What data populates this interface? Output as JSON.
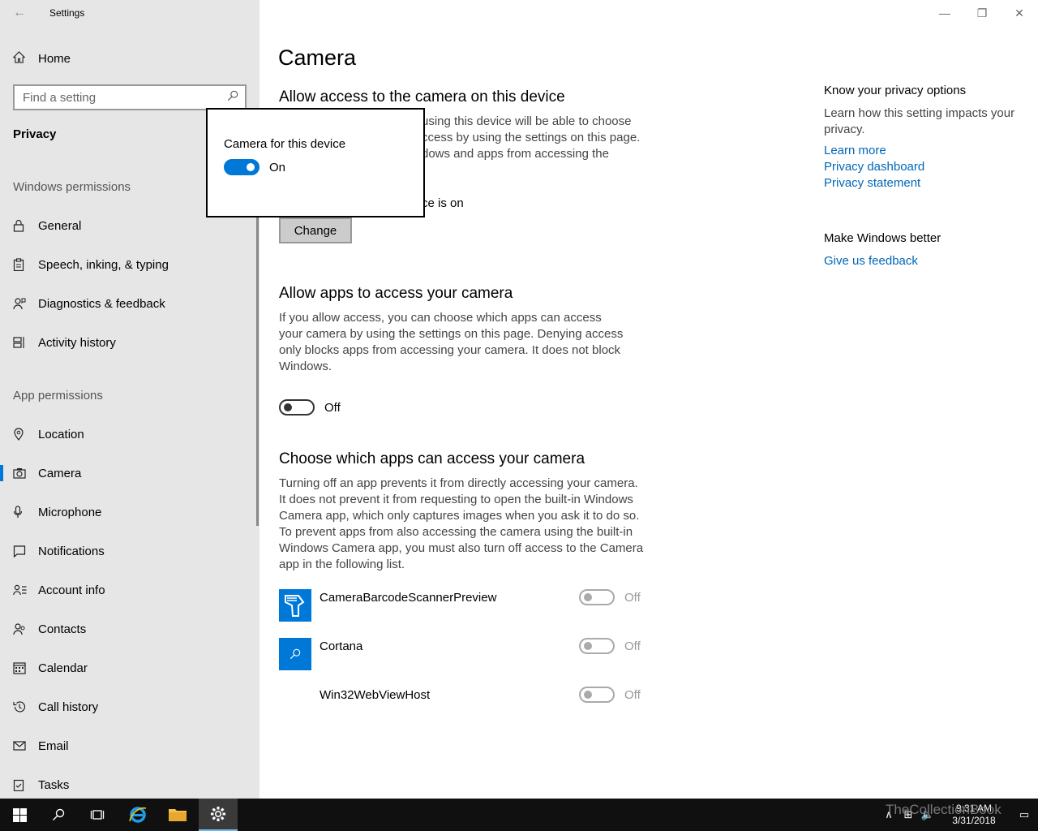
{
  "window": {
    "title": "Settings",
    "minimize_glyph": "—",
    "restore_glyph": "❐",
    "close_glyph": "✕"
  },
  "sidebar": {
    "home_label": "Home",
    "search_placeholder": "Find a setting",
    "section_title": "Privacy",
    "windows_permissions_label": "Windows permissions",
    "windows_permissions": [
      {
        "label": "General",
        "icon": "lock-icon"
      },
      {
        "label": "Speech, inking, & typing",
        "icon": "clipboard-icon"
      },
      {
        "label": "Diagnostics & feedback",
        "icon": "person-feedback-icon"
      },
      {
        "label": "Activity history",
        "icon": "timeline-icon"
      }
    ],
    "app_permissions_label": "App permissions",
    "app_permissions": [
      {
        "label": "Location",
        "icon": "location-icon"
      },
      {
        "label": "Camera",
        "icon": "camera-icon",
        "active": true
      },
      {
        "label": "Microphone",
        "icon": "microphone-icon"
      },
      {
        "label": "Notifications",
        "icon": "notifications-icon"
      },
      {
        "label": "Account info",
        "icon": "account-info-icon"
      },
      {
        "label": "Contacts",
        "icon": "contacts-icon"
      },
      {
        "label": "Calendar",
        "icon": "calendar-icon"
      },
      {
        "label": "Call history",
        "icon": "call-history-icon"
      },
      {
        "label": "Email",
        "icon": "email-icon"
      },
      {
        "label": "Tasks",
        "icon": "tasks-icon"
      }
    ]
  },
  "main": {
    "page_title": "Camera",
    "device_section": {
      "heading": "Allow access to the camera on this device",
      "description_line1": "using this device will be able to choose",
      "description_line2": "ccess by using the settings on this page.",
      "description_line3": "dows and apps from accessing the",
      "status": "ce is on",
      "change_button": "Change"
    },
    "apps_section": {
      "heading": "Allow apps to access your camera",
      "description": "If you allow access, you can choose which apps can access your camera by using the settings on this page. Denying access only blocks apps from accessing your camera. It does not block Windows.",
      "toggle_state": "Off"
    },
    "choose_section": {
      "heading": "Choose which apps can access your camera",
      "description": "Turning off an app prevents it from directly accessing your camera. It does not prevent it from requesting to open the built-in Windows Camera app, which only captures images when you ask it to do so. To prevent apps from also accessing the camera using the built-in Windows Camera app, you must also turn off access to the Camera app in the following list.",
      "apps": [
        {
          "name": "CameraBarcodeScannerPreview",
          "state": "Off",
          "icon": "barcode-scanner-icon"
        },
        {
          "name": "Cortana",
          "state": "Off",
          "icon": "cortana-search-icon"
        },
        {
          "name": "Win32WebViewHost",
          "state": "Off",
          "icon": ""
        }
      ]
    }
  },
  "right_panel": {
    "privacy_title": "Know your privacy options",
    "privacy_text": "Learn how this setting impacts your privacy.",
    "links": [
      "Learn more",
      "Privacy dashboard",
      "Privacy statement"
    ],
    "feedback_title": "Make Windows better",
    "feedback_link": "Give us feedback"
  },
  "popup": {
    "title": "Camera for this device",
    "toggle_state": "On"
  },
  "taskbar": {
    "time": "9:31 AM",
    "date": "3/31/2018",
    "watermark": "TheCollectionBook"
  },
  "colors": {
    "accent": "#0078d7",
    "link": "#0067b8",
    "sidebar_bg": "#e6e6e6",
    "taskbar_bg": "#101010"
  }
}
